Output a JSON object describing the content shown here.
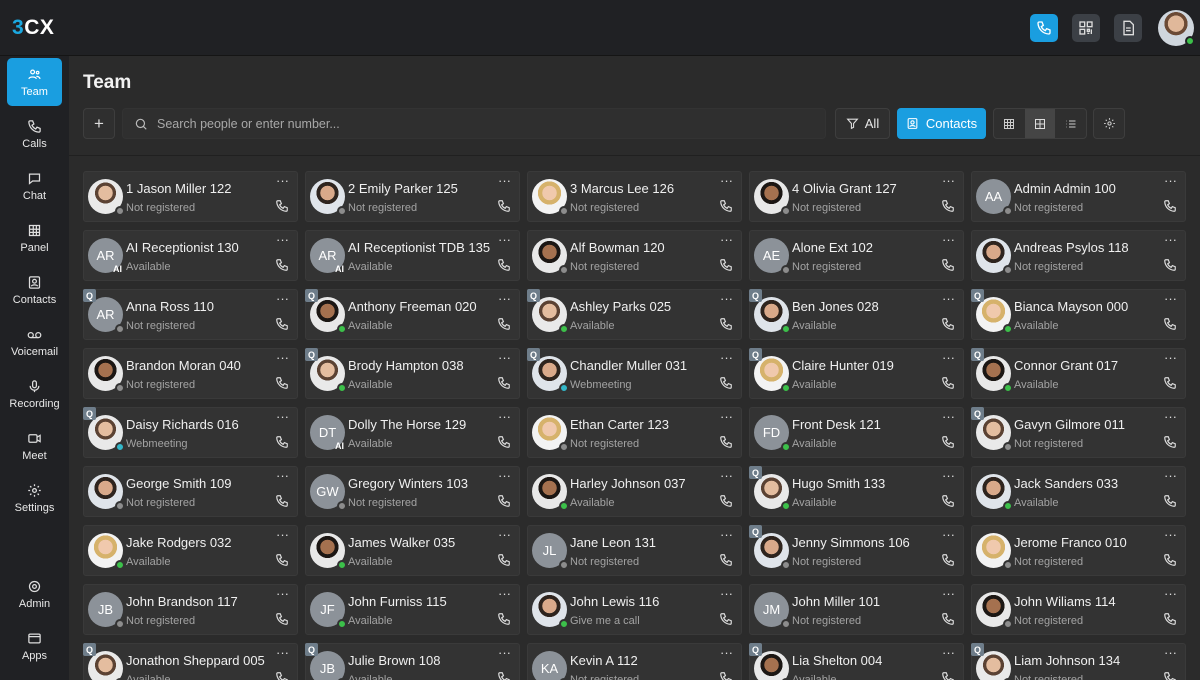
{
  "app": {
    "logo": "3CX",
    "logo_accent": "3",
    "logo_rest": "CX"
  },
  "colors": {
    "accent": "#1a9ee0",
    "available": "#3cc04a",
    "webmeeting": "#33b7c9",
    "not_registered": "#8c8c8c"
  },
  "topbar": {
    "icons": [
      "phone-icon",
      "qr-code-icon",
      "document-icon"
    ],
    "user_status": "available"
  },
  "sidebar": {
    "items": [
      {
        "label": "Team",
        "icon": "team-icon",
        "active": true
      },
      {
        "label": "Calls",
        "icon": "phone-icon"
      },
      {
        "label": "Chat",
        "icon": "chat-icon"
      },
      {
        "label": "Panel",
        "icon": "panel-icon"
      },
      {
        "label": "Contacts",
        "icon": "contacts-icon"
      },
      {
        "label": "Voicemail",
        "icon": "voicemail-icon"
      },
      {
        "label": "Recording",
        "icon": "microphone-icon"
      },
      {
        "label": "Meet",
        "icon": "video-icon"
      },
      {
        "label": "Settings",
        "icon": "gear-icon"
      },
      {
        "label": "Admin",
        "icon": "admin-gear-icon"
      },
      {
        "label": "Apps",
        "icon": "apps-icon"
      }
    ]
  },
  "page": {
    "title": "Team"
  },
  "toolbar": {
    "add_label": "+",
    "search_placeholder": "Search people or enter number...",
    "filter_label": "All",
    "contacts_label": "Contacts"
  },
  "contacts": [
    {
      "name": "1 Jason Miller 122",
      "status": "Not registered",
      "state": "offline",
      "avatar": "photo"
    },
    {
      "name": "2 Emily Parker 125",
      "status": "Not registered",
      "state": "offline",
      "avatar": "photo"
    },
    {
      "name": "3 Marcus Lee 126",
      "status": "Not registered",
      "state": "offline",
      "avatar": "photo"
    },
    {
      "name": "4 Olivia Grant 127",
      "status": "Not registered",
      "state": "offline",
      "avatar": "photo"
    },
    {
      "name": "Admin Admin 100",
      "status": "Not registered",
      "state": "offline",
      "initials": "AA"
    },
    {
      "name": "AI Receptionist 130",
      "status": "Available",
      "state": "ai",
      "initials": "AR"
    },
    {
      "name": "AI Receptionist TDB 135",
      "status": "Available",
      "state": "ai",
      "initials": "AR"
    },
    {
      "name": "Alf Bowman 120",
      "status": "Not registered",
      "state": "offline",
      "avatar": "photo"
    },
    {
      "name": "Alone Ext 102",
      "status": "Not registered",
      "state": "offline",
      "initials": "AE"
    },
    {
      "name": "Andreas Psylos 118",
      "status": "Not registered",
      "state": "offline",
      "avatar": "photo"
    },
    {
      "name": "Anna Ross 110",
      "status": "Not registered",
      "state": "offline",
      "initials": "AR",
      "queue": true
    },
    {
      "name": "Anthony Freeman 020",
      "status": "Available",
      "state": "available",
      "avatar": "photo",
      "queue": true
    },
    {
      "name": "Ashley Parks 025",
      "status": "Available",
      "state": "available",
      "avatar": "photo",
      "queue": true
    },
    {
      "name": "Ben Jones 028",
      "status": "Available",
      "state": "available",
      "avatar": "photo",
      "queue": true
    },
    {
      "name": "Bianca Mayson 000",
      "status": "Available",
      "state": "available",
      "avatar": "photo",
      "queue": true
    },
    {
      "name": "Brandon Moran 040",
      "status": "Not registered",
      "state": "offline",
      "avatar": "photo"
    },
    {
      "name": "Brody Hampton 038",
      "status": "Available",
      "state": "available",
      "avatar": "photo",
      "queue": true
    },
    {
      "name": "Chandler Muller 031",
      "status": "Webmeeting",
      "state": "webmeeting",
      "avatar": "photo",
      "queue": true
    },
    {
      "name": "Claire Hunter 019",
      "status": "Available",
      "state": "available",
      "avatar": "photo",
      "queue": true
    },
    {
      "name": "Connor Grant 017",
      "status": "Available",
      "state": "available",
      "avatar": "photo",
      "queue": true
    },
    {
      "name": "Daisy Richards 016",
      "status": "Webmeeting",
      "state": "webmeeting",
      "avatar": "photo",
      "queue": true
    },
    {
      "name": "Dolly The Horse 129",
      "status": "Available",
      "state": "ai",
      "initials": "DT"
    },
    {
      "name": "Ethan Carter 123",
      "status": "Not registered",
      "state": "offline",
      "avatar": "photo"
    },
    {
      "name": "Front Desk 121",
      "status": "Available",
      "state": "available",
      "initials": "FD"
    },
    {
      "name": "Gavyn Gilmore 011",
      "status": "Not registered",
      "state": "offline",
      "avatar": "photo",
      "queue": true
    },
    {
      "name": "George Smith 109",
      "status": "Not registered",
      "state": "offline",
      "avatar": "photo"
    },
    {
      "name": "Gregory Winters 103",
      "status": "Not registered",
      "state": "offline",
      "initials": "GW"
    },
    {
      "name": "Harley Johnson 037",
      "status": "Available",
      "state": "available",
      "avatar": "photo"
    },
    {
      "name": "Hugo Smith 133",
      "status": "Available",
      "state": "available",
      "avatar": "photo",
      "queue": true
    },
    {
      "name": "Jack Sanders 033",
      "status": "Available",
      "state": "available",
      "avatar": "photo"
    },
    {
      "name": "Jake Rodgers 032",
      "status": "Available",
      "state": "available",
      "avatar": "photo"
    },
    {
      "name": "James Walker 035",
      "status": "Available",
      "state": "available",
      "avatar": "photo"
    },
    {
      "name": "Jane Leon 131",
      "status": "Not registered",
      "state": "offline",
      "initials": "JL"
    },
    {
      "name": "Jenny Simmons 106",
      "status": "Not registered",
      "state": "offline",
      "avatar": "photo",
      "queue": true
    },
    {
      "name": "Jerome Franco 010",
      "status": "Not registered",
      "state": "offline",
      "avatar": "photo"
    },
    {
      "name": "John Brandson 117",
      "status": "Not registered",
      "state": "offline",
      "initials": "JB"
    },
    {
      "name": "John Furniss 115",
      "status": "Available",
      "state": "available",
      "initials": "JF"
    },
    {
      "name": "John Lewis 116",
      "status": "Give me a call",
      "state": "available",
      "avatar": "photo"
    },
    {
      "name": "John Miller 101",
      "status": "Not registered",
      "state": "offline",
      "initials": "JM"
    },
    {
      "name": "John Wiliams 114",
      "status": "Not registered",
      "state": "offline",
      "avatar": "photo"
    },
    {
      "name": "Jonathon Sheppard 005",
      "status": "Available",
      "state": "available",
      "avatar": "photo",
      "queue": true
    },
    {
      "name": "Julie Brown 108",
      "status": "Available",
      "state": "available",
      "initials": "JB",
      "queue": true
    },
    {
      "name": "Kevin A 112",
      "status": "Not registered",
      "state": "offline",
      "initials": "KA"
    },
    {
      "name": "Lia Shelton 004",
      "status": "Available",
      "state": "available",
      "avatar": "photo",
      "queue": true
    },
    {
      "name": "Liam Johnson 134",
      "status": "Not registered",
      "state": "offline",
      "avatar": "photo",
      "queue": true
    }
  ],
  "card_icons": {
    "more": "···",
    "call": "phone-icon",
    "queue_badge": "Q",
    "ai_badge": "AI"
  }
}
